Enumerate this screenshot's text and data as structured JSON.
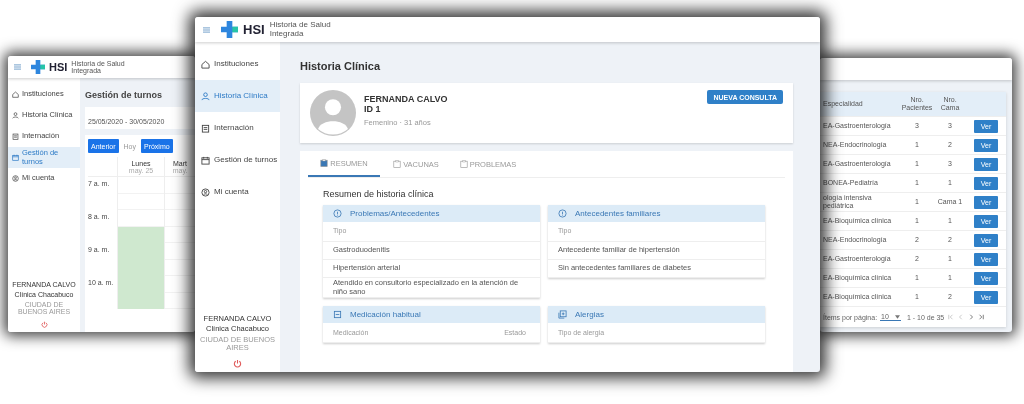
{
  "left_window": {
    "header": {
      "logo": "HSI",
      "subtitle": "Historia de Salud Integrada"
    },
    "sidebar": {
      "items": [
        {
          "label": "Instituciones",
          "selected": false
        },
        {
          "label": "Historia Clínica",
          "selected": false
        },
        {
          "label": "Internación",
          "selected": false
        },
        {
          "label": "Gestión de turnos",
          "selected": true
        },
        {
          "label": "Mi cuenta",
          "selected": false
        }
      ],
      "user": "FERNANDA CALVO",
      "clinic": "Clínica Chacabuco",
      "city": "CIUDAD DE BUENOS AIRES"
    },
    "title": "Gestión de turnos",
    "week_field": {
      "value": "25/05/2020 - 30/05/2020"
    },
    "nav_buttons": [
      {
        "label": "Anterior",
        "kind": "primary"
      },
      {
        "label": "Hoy",
        "kind": "flat"
      },
      {
        "label": "Próximo",
        "kind": "primary"
      }
    ],
    "calendar": {
      "days": [
        {
          "name": "Lunes",
          "date": "may. 25",
          "slots": [
            false,
            false,
            false,
            true,
            true,
            true,
            true,
            true
          ]
        },
        {
          "name": "Mart",
          "date": "may.",
          "slots": [
            false,
            false,
            false,
            false,
            false,
            false,
            false,
            false
          ]
        }
      ],
      "hours": [
        "7 a. m.",
        "8 a. m.",
        "9 a. m.",
        "10 a. m."
      ]
    }
  },
  "right_window": {
    "table": {
      "columns": [
        "Especialidad",
        "Nro. Pacientes",
        "Nro. Cama"
      ],
      "rows": [
        {
          "cells": [
            "EA-Gastroenterología",
            "3",
            "3"
          ],
          "action": "Ver"
        },
        {
          "cells": [
            "NEA-Endocrinología",
            "1",
            "2"
          ],
          "action": "Ver"
        },
        {
          "cells": [
            "EA-Gastroenterología",
            "1",
            "3"
          ],
          "action": "Ver"
        },
        {
          "cells": [
            "BONEA-Pediatría",
            "1",
            "1"
          ],
          "action": "Ver"
        },
        {
          "cells": [
            "ología intensiva pediátrica",
            "1",
            "Cama 1"
          ],
          "action": "Ver"
        },
        {
          "cells": [
            "EA-Bioquímica clínica",
            "1",
            "1"
          ],
          "action": "Ver"
        },
        {
          "cells": [
            "NEA-Endocrinología",
            "2",
            "2"
          ],
          "action": "Ver"
        },
        {
          "cells": [
            "EA-Gastroenterología",
            "2",
            "1"
          ],
          "action": "Ver"
        },
        {
          "cells": [
            "EA-Bioquímica clínica",
            "1",
            "1"
          ],
          "action": "Ver"
        },
        {
          "cells": [
            "EA-Bioquímica clínica",
            "1",
            "2"
          ],
          "action": "Ver"
        }
      ],
      "paginator": {
        "label": "Ítems por página:",
        "page_size": "10",
        "range": "1 - 10 de 35"
      }
    }
  },
  "main_window": {
    "header": {
      "logo": "HSI",
      "subtitle": "Historia de Salud Integrada"
    },
    "sidebar": {
      "items": [
        {
          "label": "Instituciones",
          "selected": false
        },
        {
          "label": "Historia Clínica",
          "selected": true
        },
        {
          "label": "Internación",
          "selected": false
        },
        {
          "label": "Gestión de turnos",
          "selected": false
        },
        {
          "label": "Mi cuenta",
          "selected": false
        }
      ],
      "user": "FERNANDA CALVO",
      "clinic": "Clínica Chacabuco",
      "city": "CIUDAD DE BUENOS AIRES"
    },
    "title": "Historia Clínica",
    "patient": {
      "name": "FERNANDA CALVO",
      "id": "ID 1",
      "details": "Femenino · 31 años"
    },
    "action_button": "NUEVA CONSULTA",
    "tabs": [
      {
        "label": "RESUMEN",
        "selected": true
      },
      {
        "label": "VACUNAS",
        "selected": false
      },
      {
        "label": "PROBLEMAS",
        "selected": false
      }
    ],
    "summary_title": "Resumen de historia clínica",
    "panels": [
      {
        "title": "Problemas/Antecedentes",
        "columns": [
          "Tipo"
        ],
        "rows": [
          "Gastroduodenitis",
          "Hipertensión arterial",
          "Atendido en consultorio especializado en la atención de niño sano"
        ]
      },
      {
        "title": "Antecedentes familiares",
        "columns": [
          "Tipo"
        ],
        "rows": [
          "Antecedente familiar de hipertensión",
          "Sin antecedentes familiares de diabetes"
        ]
      },
      {
        "title": "Medicación habitual",
        "columns": [
          "Medicación",
          "Estado"
        ]
      },
      {
        "title": "Alergias",
        "columns": [
          "Tipo de alergia"
        ]
      }
    ]
  }
}
